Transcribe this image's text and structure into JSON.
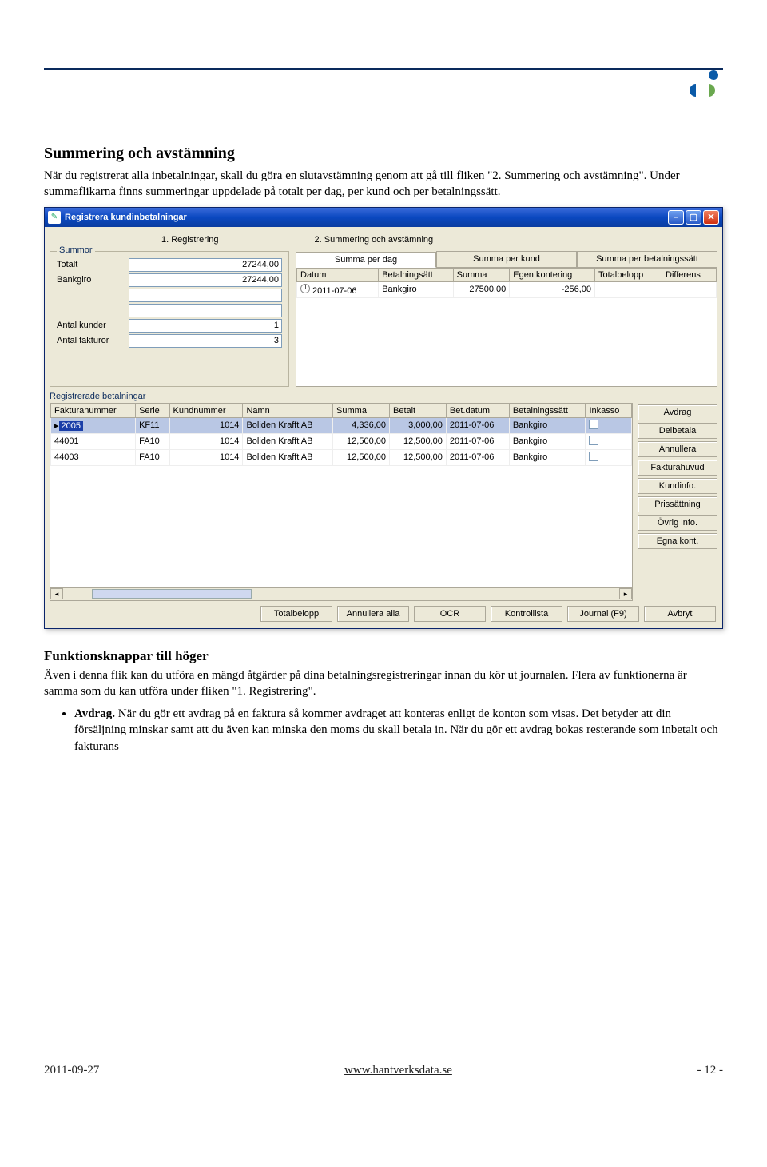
{
  "document": {
    "heading": "Summering och avstämning",
    "intro": "När du registrerat alla inbetalningar, skall du göra en slutavstämning genom att gå till fliken \"2. Summering och avstämning\". Under summaflikarna finns summeringar uppdelade på totalt per dag, per kund och per betalningssätt.",
    "subheading": "Funktionsknappar till höger",
    "sub_text": "Även i denna flik kan du utföra en mängd åtgärder på dina betalningsregistreringar innan du kör ut journalen. Flera av funktionerna är samma som du kan utföra under fliken \"1. Registrering\".",
    "bullet_label": "Avdrag.",
    "bullet_text": " När du gör ett avdrag på en faktura så kommer avdraget att konteras enligt de konton som visas. Det betyder att din försäljning minskar samt att du även kan minska den moms du skall betala in. När du gör ett avdrag bokas resterande som inbetalt och fakturans"
  },
  "win": {
    "title": "Registrera kundinbetalningar",
    "tabs": [
      "1. Registrering",
      "2. Summering och avstämning"
    ],
    "summor": {
      "legend": "Summor",
      "labels": {
        "totalt": "Totalt",
        "bankgiro": "Bankgiro",
        "antal_kunder": "Antal kunder",
        "antal_fakturor": "Antal fakturor"
      },
      "values": {
        "totalt": "27244,00",
        "bankgiro": "27244,00",
        "b1": "",
        "b2": "",
        "antal_kunder": "1",
        "antal_fakturor": "3"
      }
    },
    "sumtabs": [
      "Summa per dag",
      "Summa per kund",
      "Summa per betalningssätt"
    ],
    "grid1": {
      "cols": [
        "Datum",
        "Betalningsätt",
        "Summa",
        "Egen kontering",
        "Totalbelopp",
        "Differens"
      ],
      "row": {
        "datum": "2011-07-06",
        "bet": "Bankgiro",
        "summa": "27500,00",
        "egen": "-256,00",
        "total": "",
        "diff": ""
      }
    },
    "section2": "Registrerade betalningar",
    "grid2": {
      "cols": [
        "Fakturanummer",
        "Serie",
        "Kundnummer",
        "Namn",
        "Summa",
        "Betalt",
        "Bet.datum",
        "Betalningssätt",
        "Inkasso"
      ],
      "rows": [
        {
          "fn": "2005",
          "serie": "KF11",
          "kund": "1014",
          "namn": "Boliden Krafft AB",
          "summa": "4,336,00",
          "betalt": "3,000,00",
          "datum": "2011-07-06",
          "bs": "Bankgiro"
        },
        {
          "fn": "44001",
          "serie": "FA10",
          "kund": "1014",
          "namn": "Boliden Krafft AB",
          "summa": "12,500,00",
          "betalt": "12,500,00",
          "datum": "2011-07-06",
          "bs": "Bankgiro"
        },
        {
          "fn": "44003",
          "serie": "FA10",
          "kund": "1014",
          "namn": "Boliden Krafft AB",
          "summa": "12,500,00",
          "betalt": "12,500,00",
          "datum": "2011-07-06",
          "bs": "Bankgiro"
        }
      ]
    },
    "side_buttons": [
      "Avdrag",
      "Delbetala",
      "Annullera",
      "Fakturahuvud",
      "Kundinfo.",
      "Prissättning",
      "Övrig info.",
      "Egna kont."
    ],
    "bottom_buttons": [
      "Totalbelopp",
      "Annullera alla",
      "OCR",
      "Kontrollista",
      "Journal (F9)",
      "Avbryt"
    ]
  },
  "footer": {
    "date": "2011-09-27",
    "url": "www.hantverksdata.se",
    "page": "- 12 -"
  }
}
